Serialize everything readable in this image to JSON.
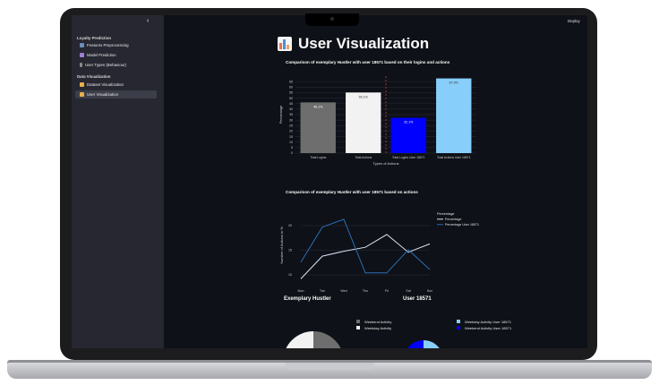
{
  "sidebar": {
    "collapse_glyph": "‹",
    "sections": [
      {
        "label": "Loyalty Prediction",
        "items": [
          {
            "label": "Features Preprocessing",
            "icon": "wrench-icon",
            "color": "#6c8ebf"
          },
          {
            "label": "Model Prediction",
            "icon": "robot-icon",
            "color": "#a07fd6"
          },
          {
            "label": "User Types (Behaviour)",
            "icon": "user-icon",
            "color": "#8b8b8b"
          }
        ]
      },
      {
        "label": "Data Visualization",
        "items": [
          {
            "label": "Dataset Visualization",
            "icon": "chart-icon",
            "color": "#e8b04a"
          },
          {
            "label": "User Visualization",
            "icon": "chart-icon",
            "color": "#e8b04a",
            "active": true
          }
        ]
      }
    ]
  },
  "topbar": {
    "deploy_label": "Deploy",
    "menu_glyph": "⋮"
  },
  "page": {
    "title": "User Visualization",
    "title_icon": "bar-chart-icon"
  },
  "charts": {
    "bar": {
      "title": "Comparison of exemplary Hustler with user 18571 based on their logins and actions"
    },
    "line": {
      "title": "Comparison of exemplary Hustler with user 18571 based on actions"
    }
  },
  "chart_data": [
    {
      "type": "bar",
      "title": "Comparison of exemplary Hustler with user 18571 based on their logins and actions",
      "categories": [
        "Total Logins",
        "Total Actions",
        "Total Logins User 18571",
        "Total Actions User 18571"
      ],
      "values": [
        46.1,
        55.1,
        32.1,
        67.9
      ],
      "data_labels": [
        "46.1%",
        "55.1%",
        "32.1%",
        "67.9%"
      ],
      "colors": [
        "#6e6e6e",
        "#f2f2f2",
        "#0000ff",
        "#87cefa"
      ],
      "xlabel": "Types of Actions",
      "ylabel": "Percentage",
      "ylim": [
        0,
        70
      ],
      "yticks": [
        0,
        5,
        10,
        15,
        20,
        25,
        30,
        35,
        40,
        45,
        50,
        55,
        60,
        65
      ],
      "divider_between": [
        1,
        2
      ]
    },
    {
      "type": "line",
      "title": "Comparison of exemplary Hustler with user 18571 based on actions",
      "categories": [
        "Mon",
        "Tue",
        "Wed",
        "Thu",
        "Fri",
        "Sat",
        "Sun"
      ],
      "ylabel": "Number of Actions in %",
      "ylim": [
        8,
        24
      ],
      "yticks": [
        10,
        15,
        20
      ],
      "legend_title": "Percentage",
      "series": [
        {
          "name": "Percentage",
          "color": "#d8e3f4",
          "values": [
            9.2,
            13.8,
            14.8,
            15.6,
            18.2,
            14.6,
            16.3
          ]
        },
        {
          "name": "Percentage User 18571",
          "color": "#2a6fb5",
          "values": [
            12.6,
            19.7,
            21.3,
            10.4,
            10.4,
            15.1,
            11.1
          ]
        }
      ]
    },
    {
      "type": "pie",
      "title": "Exemplary Hustler",
      "labels": [
        "Weekend Activity",
        "Weekday Activity"
      ],
      "colors": [
        "#6e6e6e",
        "#f2f2f2"
      ]
    },
    {
      "type": "pie",
      "title": "User 18571",
      "labels": [
        "Weekday Activity User 18571",
        "Weekend Activity User 18571"
      ],
      "colors": [
        "#87cefa",
        "#0000ff"
      ]
    }
  ]
}
